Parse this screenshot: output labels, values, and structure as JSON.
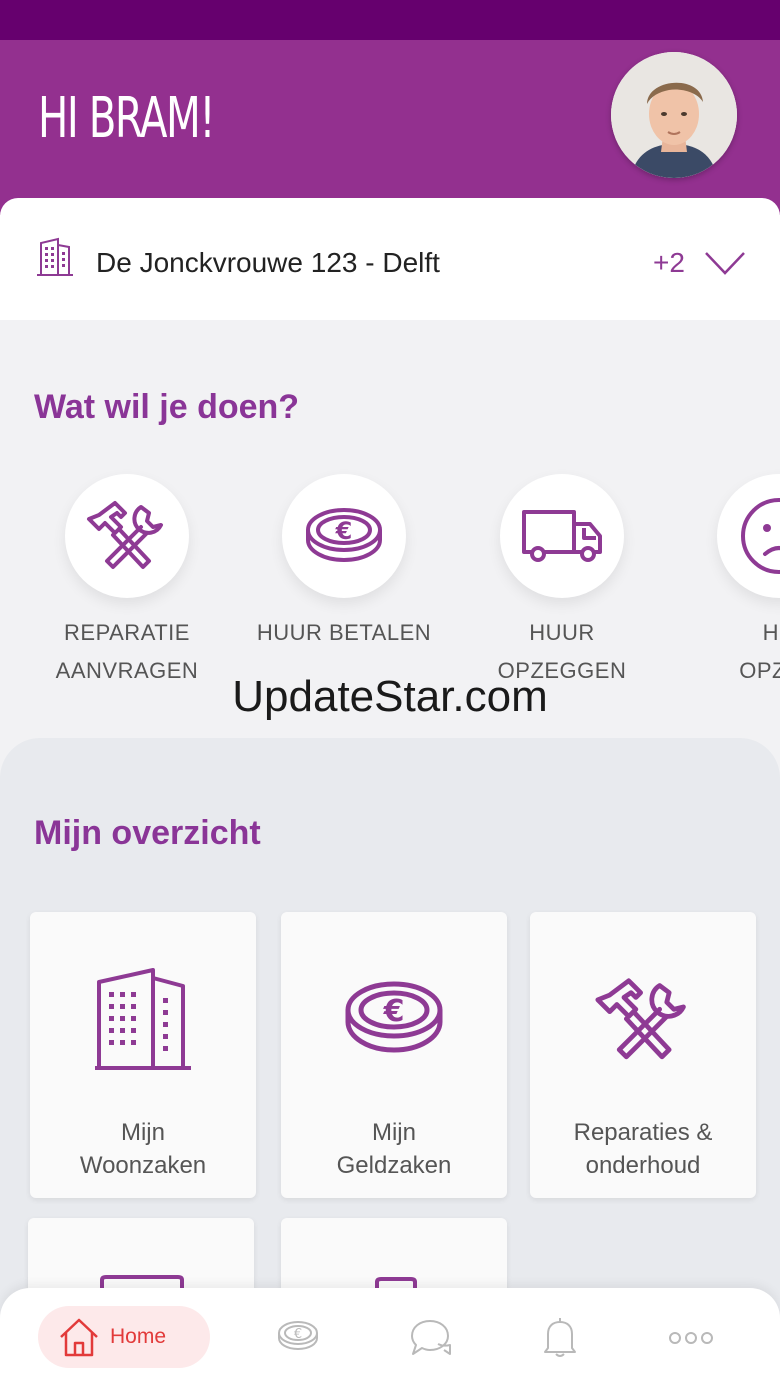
{
  "header": {
    "greeting": "HI BRAM!"
  },
  "address": {
    "text": "De Jonckvrouwe 123 - Delft",
    "extra_count": "+2"
  },
  "actions": {
    "title": "Wat wil je doen?",
    "items": [
      {
        "line1": "REPARATIE",
        "line2": "AANVRAGEN",
        "icon": "tools-icon"
      },
      {
        "line1": "HUUR BETALEN",
        "line2": "",
        "icon": "euro-coin-icon"
      },
      {
        "line1": "HUUR",
        "line2": "OPZEGGEN",
        "icon": "truck-icon"
      },
      {
        "line1": "HU",
        "line2": "OPZEG",
        "icon": "sad-face-icon"
      }
    ]
  },
  "watermark": "UpdateStar.com",
  "overview": {
    "title": "Mijn overzicht",
    "tiles": [
      {
        "line1": "Mijn",
        "line2": "Woonzaken",
        "icon": "building-icon"
      },
      {
        "line1": "Mijn",
        "line2": "Geldzaken",
        "icon": "euro-coin-icon"
      },
      {
        "line1": "Reparaties &",
        "line2": "onderhoud",
        "icon": "tools-icon"
      }
    ]
  },
  "nav": {
    "home_label": "Home"
  },
  "colors": {
    "brand_purple": "#93308f",
    "dark_purple": "#66006e",
    "accent_red": "#e23a3a"
  }
}
